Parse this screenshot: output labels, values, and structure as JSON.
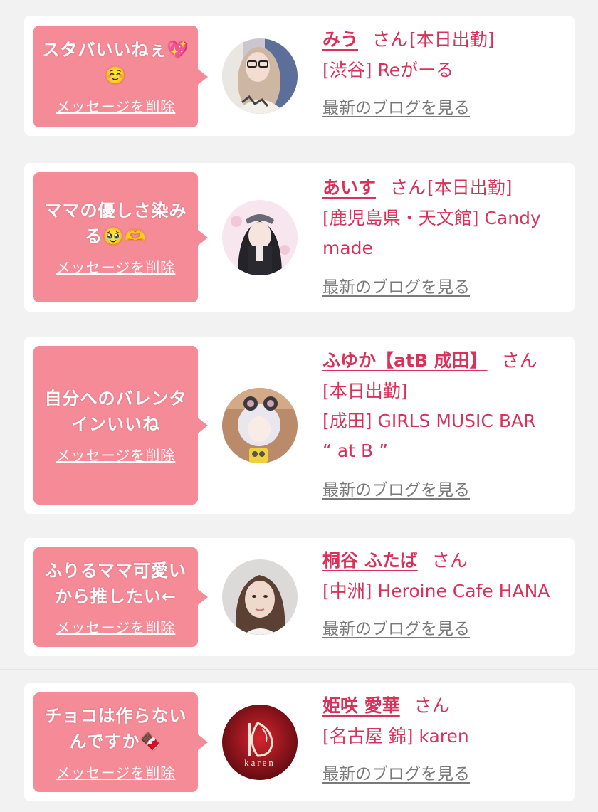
{
  "delete_label": "メッセージを削除",
  "blog_label": "最新のブログを見る",
  "san_label": "さん",
  "colors": {
    "bubble": "#f68b98",
    "name": "#d9325a",
    "link_gray": "#7a7a7a",
    "background": "#f2f2f3"
  },
  "items": [
    {
      "message_lines": [
        "スタバいいねぇ💖",
        "☺️"
      ],
      "name": "みう",
      "status": "[本日出勤]",
      "shop": "[渋谷] Reがーる",
      "avatar_icon": "photo-avatar"
    },
    {
      "message_lines": [
        "ママの優しさ染み",
        "る🥹🫶"
      ],
      "name": "あいす",
      "status": "[本日出勤]",
      "shop_lines": [
        "[鹿児島県・天文館] Candy",
        "made"
      ],
      "avatar_icon": "photo-avatar"
    },
    {
      "message_lines": [
        "自分へのバレンタ",
        "インいいね"
      ],
      "name": "ふゆか【atB 成田】",
      "status": "[本日出勤]",
      "shop_lines": [
        "[成田] GIRLS MUSIC BAR",
        "“ at B ”"
      ],
      "avatar_icon": "photo-avatar"
    },
    {
      "message_lines": [
        "ふりるママ可愛い",
        "から推したい←"
      ],
      "name": "桐谷 ふたば",
      "shop": "[中洲] Heroine Cafe HANA",
      "avatar_icon": "photo-avatar"
    },
    {
      "message_lines": [
        "チョコは作らない",
        "んですか🍫"
      ],
      "name": "姫咲 愛華",
      "shop": "[名古屋 錦] karen",
      "avatar_icon": "karen-logo-avatar",
      "avatar_logo_text": "karen"
    }
  ]
}
